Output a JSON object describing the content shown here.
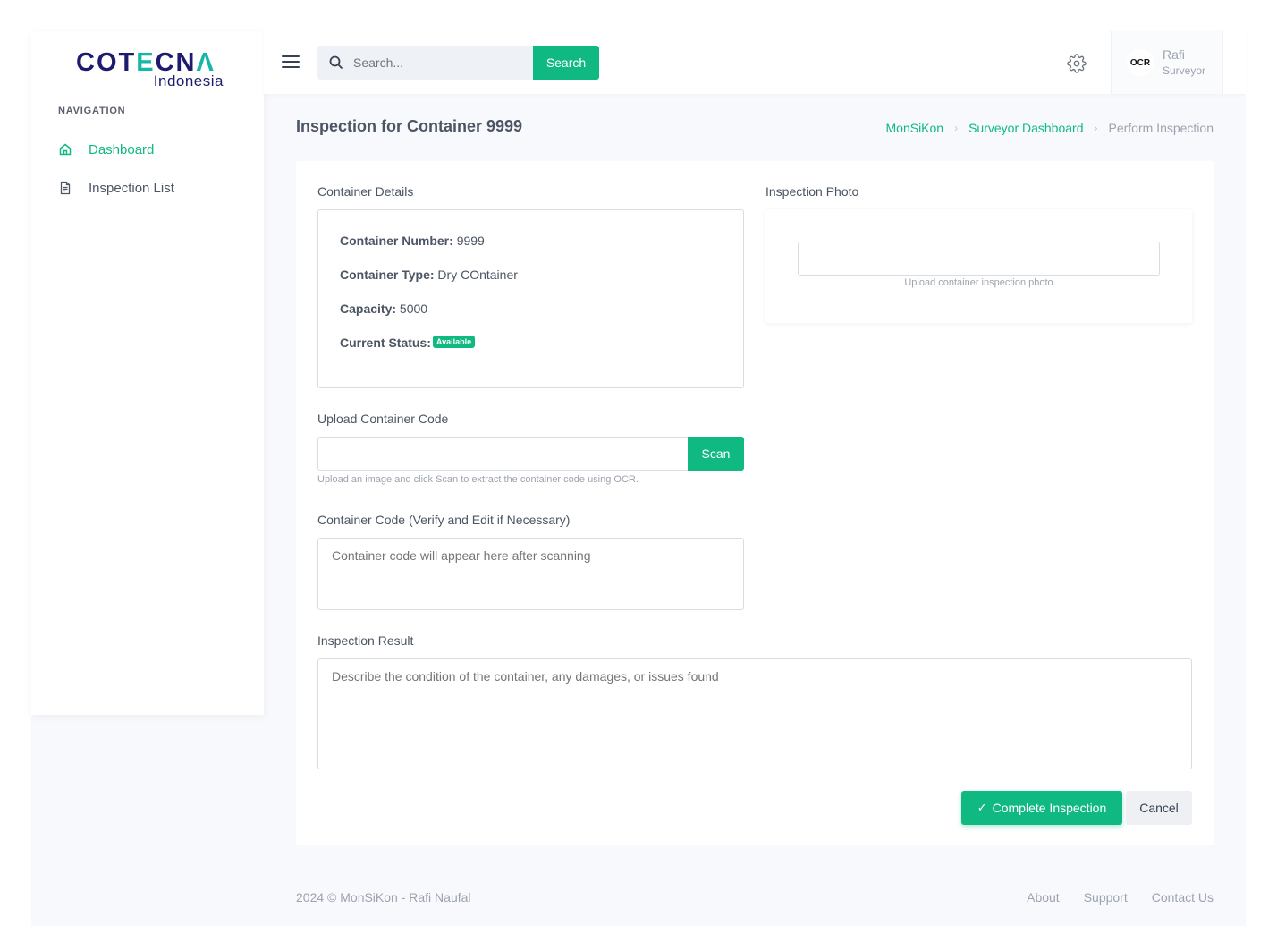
{
  "brand": {
    "logo_main_a": "COT",
    "logo_main_e": "E",
    "logo_main_b": "CN",
    "logo_main_c": "Λ",
    "logo_sub": "Indonesia"
  },
  "sidebar": {
    "nav_title": "NAVIGATION",
    "items": [
      {
        "label": "Dashboard",
        "icon": "home-icon",
        "active": true
      },
      {
        "label": "Inspection List",
        "icon": "document-icon",
        "active": false
      }
    ]
  },
  "topbar": {
    "search_placeholder": "Search...",
    "search_button": "Search",
    "avatar_text": "OCR",
    "user_name": "Rafi",
    "user_role": "Surveyor"
  },
  "page": {
    "title": "Inspection for Container 9999",
    "breadcrumb": [
      "MonSiKon",
      "Surveyor Dashboard",
      "Perform Inspection"
    ]
  },
  "container_details": {
    "label": "Container Details",
    "number_label": "Container Number:",
    "number_value": "9999",
    "type_label": "Container Type:",
    "type_value": "Dry COntainer",
    "capacity_label": "Capacity:",
    "capacity_value": "5000",
    "status_label": "Current Status:",
    "status_value": "Available"
  },
  "inspection_photo": {
    "label": "Inspection Photo",
    "help": "Upload container inspection photo"
  },
  "upload_code": {
    "label": "Upload Container Code",
    "scan_button": "Scan",
    "help": "Upload an image and click Scan to extract the container code using OCR."
  },
  "container_code": {
    "label": "Container Code (Verify and Edit if Necessary)",
    "placeholder": "Container code will appear here after scanning"
  },
  "inspection_result": {
    "label": "Inspection Result",
    "placeholder": "Describe the condition of the container, any damages, or issues found"
  },
  "actions": {
    "complete": "Complete Inspection",
    "cancel": "Cancel"
  },
  "footer": {
    "copyright": "2024 © MonSiKon - Rafi Naufal",
    "links": [
      "About",
      "Support",
      "Contact Us"
    ]
  },
  "colors": {
    "accent": "#10b981",
    "brand_navy": "#1e1b6e",
    "brand_teal": "#14b8a6"
  }
}
